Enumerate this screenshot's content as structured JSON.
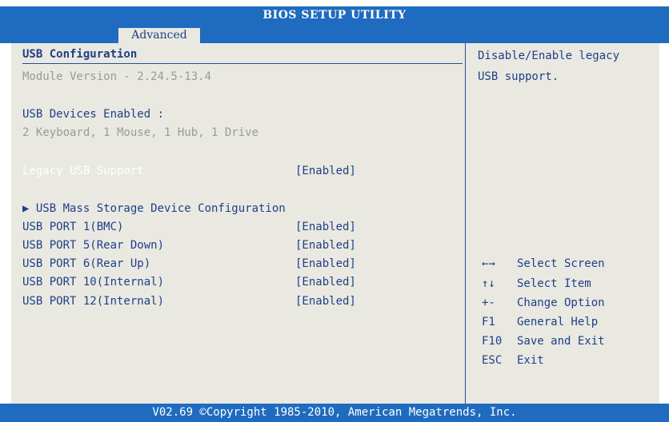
{
  "header": {
    "title": "BIOS SETUP UTILITY",
    "tab": "Advanced"
  },
  "main": {
    "section_title": "USB Configuration",
    "module_version": "Module Version - 2.24.5-13.4",
    "devices_label": "USB Devices Enabled :",
    "devices_value": "2 Keyboard, 1 Mouse, 1 Hub, 1 Drive",
    "legacy": {
      "label": "Legacy USB Support",
      "value": "[Enabled]"
    },
    "submenu": "▶ USB Mass Storage Device Configuration",
    "ports": [
      {
        "label": "USB PORT 1(BMC)",
        "value": "[Enabled]"
      },
      {
        "label": "USB PORT 5(Rear Down)",
        "value": "[Enabled]"
      },
      {
        "label": "USB PORT 6(Rear Up)",
        "value": "[Enabled]"
      },
      {
        "label": "USB PORT 10(Internal)",
        "value": "[Enabled]"
      },
      {
        "label": "USB PORT 12(Internal)",
        "value": "[Enabled]"
      }
    ]
  },
  "help": {
    "line1": "Disable/Enable legacy",
    "line2": "USB support."
  },
  "keys": [
    {
      "key": "←→",
      "desc": "Select Screen"
    },
    {
      "key": "↑↓",
      "desc": "Select Item"
    },
    {
      "key": "+-",
      "desc": "Change Option"
    },
    {
      "key": "F1",
      "desc": "General Help"
    },
    {
      "key": "F10",
      "desc": "Save and Exit"
    },
    {
      "key": "ESC",
      "desc": "Exit"
    }
  ],
  "footer": {
    "copyright": "V02.69 ©Copyright 1985-2010, American Megatrends, Inc."
  },
  "colors": {
    "header_bg": "#1f6bbf",
    "panel_bg": "#e9e9e2",
    "text": "#1f3f86",
    "disabled_text": "#9a9a9a",
    "highlight_text": "#ffffff"
  }
}
